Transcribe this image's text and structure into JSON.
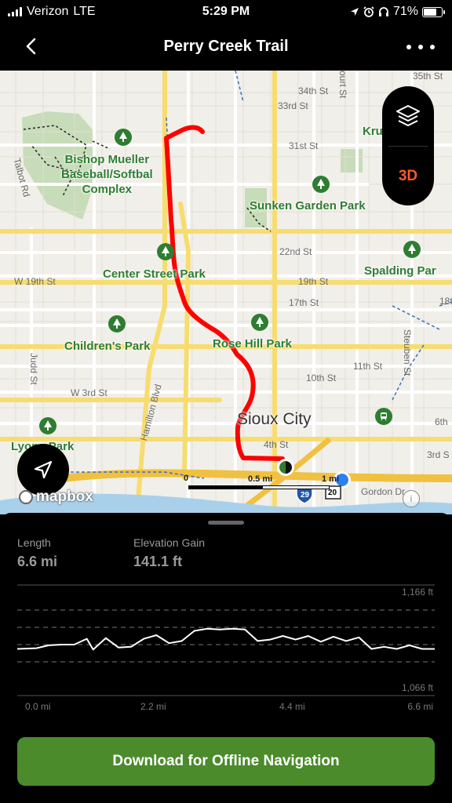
{
  "status_bar": {
    "carrier": "Verizon",
    "network": "LTE",
    "time": "5:29 PM",
    "battery": "71%",
    "battery_level": 0.71
  },
  "header": {
    "title": "Perry Creek Trail"
  },
  "map": {
    "street_labels": [
      "35th St",
      "34th St",
      "33rd St",
      "31st St",
      "Talbot Rd",
      "22nd St",
      "W 19th St",
      "19th St",
      "17th St",
      "18t",
      "11th St",
      "10th St",
      "W 3rd St",
      "Hamilton Blvd",
      "Judd St",
      "Steuben St",
      "4th St",
      "3rd S",
      "6th",
      "Gordon Dr",
      "ourt St"
    ],
    "parks": [
      "Bishop Mueller Baseball/Softball Complex",
      "Sunken Garden Park",
      "Kru",
      "Center Street Park",
      "Spalding Par",
      "Children's Park",
      "Rose Hill Park",
      "Lyons Park"
    ],
    "city": "Sioux City",
    "shields": [
      "29",
      "20"
    ],
    "btn_3d": "3D",
    "attribution": "mapbox",
    "scale": {
      "start": "0",
      "mid": "0.5 mi",
      "end": "1 mi"
    },
    "info": "i"
  },
  "stats": {
    "length_label": "Length",
    "length_value": "6.6 mi",
    "gain_label": "Elevation Gain",
    "gain_value": "141.1 ft"
  },
  "elevation_chart": {
    "y_max_label": "1,166 ft",
    "y_min_label": "1,066 ft",
    "x_labels": [
      "0.0 mi",
      "2.2 mi",
      "4.4 mi",
      "6.6 mi"
    ]
  },
  "chart_data": {
    "type": "line",
    "title": "",
    "xlabel": "",
    "ylabel": "",
    "xlim": [
      0,
      6.6
    ],
    "ylim": [
      1066,
      1166
    ],
    "series": [
      {
        "x": [
          0.0,
          0.3,
          0.5,
          0.7,
          0.9,
          1.1,
          1.2,
          1.4,
          1.6,
          1.8,
          2.0,
          2.2,
          2.4,
          2.6,
          2.8,
          3.0,
          3.2,
          3.4,
          3.6,
          3.8,
          4.0,
          4.2,
          4.4,
          4.6,
          4.8,
          5.0,
          5.2,
          5.4,
          5.6,
          5.8,
          6.0,
          6.2,
          6.4,
          6.6
        ],
        "y": [
          1110,
          1111,
          1115,
          1116,
          1116,
          1124,
          1109,
          1125,
          1112,
          1113,
          1124,
          1129,
          1118,
          1121,
          1135,
          1138,
          1137,
          1138,
          1137,
          1121,
          1123,
          1128,
          1123,
          1128,
          1120,
          1127,
          1121,
          1126,
          1110,
          1113,
          1110,
          1115,
          1110,
          1110
        ]
      }
    ]
  },
  "cta": {
    "label": "Download for Offline Navigation"
  },
  "colors": {
    "route": "#ff0000",
    "park_text": "#2e7d32",
    "accent_3d": "#ff5a2a",
    "cta_bg": "#4b8b2b"
  }
}
